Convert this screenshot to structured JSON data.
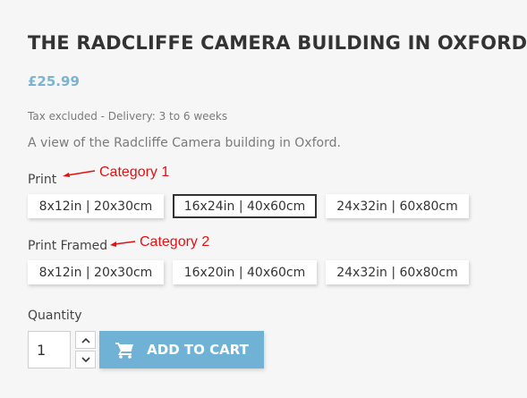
{
  "product": {
    "title": "THE RADCLIFFE CAMERA BUILDING IN OXFORD",
    "price": "£25.99",
    "tax_info": "Tax excluded - Delivery: 3 to 6 weeks",
    "description": "A view of the Radcliffe Camera building in Oxford."
  },
  "variant_groups": [
    {
      "label": "Print",
      "annotation": "Category 1",
      "options": [
        "8x12in | 20x30cm",
        "16x24in | 40x60cm",
        "24x32in | 60x80cm"
      ],
      "selected": "16x24in | 40x60cm"
    },
    {
      "label": "Print Framed",
      "annotation": "Category 2",
      "options": [
        "8x12in | 20x30cm",
        "16x20in | 40x60cm",
        "24x32in | 60x80cm"
      ],
      "selected": ""
    }
  ],
  "purchase": {
    "quantity_label": "Quantity",
    "quantity_value": "1",
    "increase_icon": "chevron-up-icon",
    "decrease_icon": "chevron-down-icon",
    "cart_icon": "shopping-cart-icon",
    "add_to_cart_label": "ADD TO CART"
  },
  "colors": {
    "price": "#7cb3d0",
    "annotation": "#e11111",
    "add_to_cart_background": "#6fb2d6",
    "selected_border": "#333333"
  }
}
